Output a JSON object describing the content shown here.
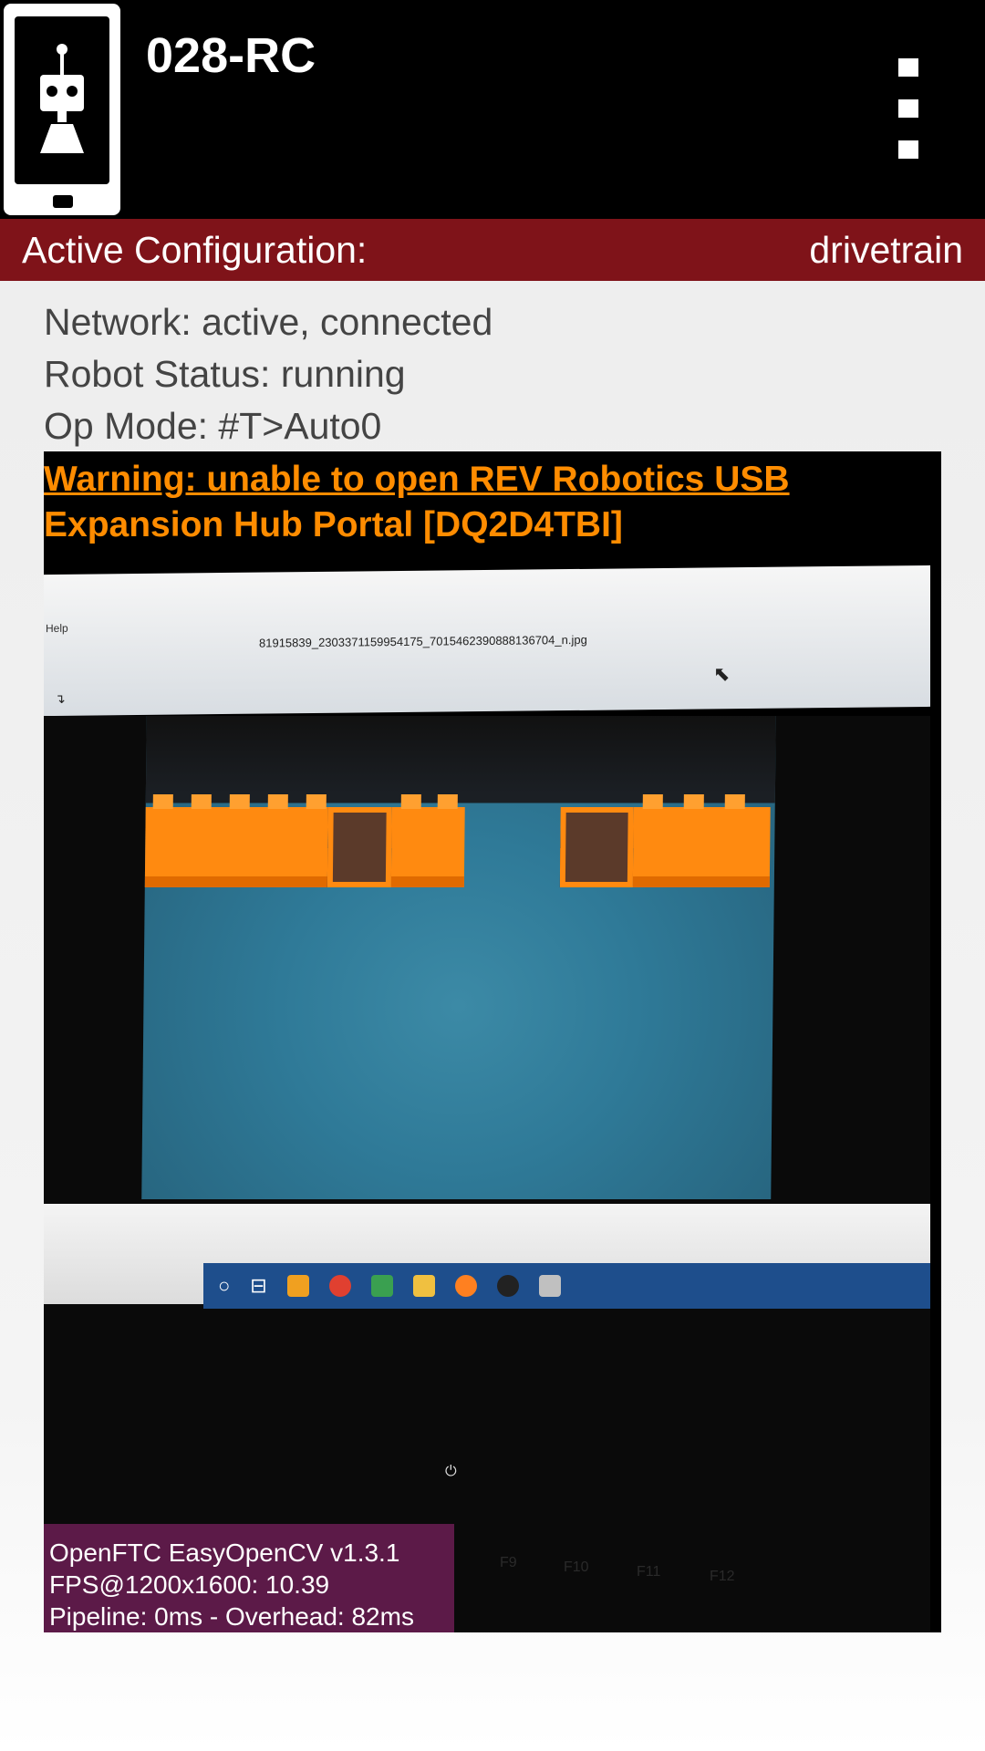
{
  "app": {
    "title": "028-RC",
    "icon": "robot-phone-icon",
    "menu_icon": "overflow-menu-icon"
  },
  "config": {
    "label": "Active Configuration:",
    "value": "drivetrain"
  },
  "status": {
    "network": "Network: active, connected",
    "robot": "Robot Status: running",
    "opmode": "Op Mode: #T>Auto0"
  },
  "warning": {
    "line1": "Warning: unable to open REV Robotics USB",
    "line2": "Expansion Hub Portal [DQ2D4TBI]"
  },
  "camera": {
    "menu_text": "Help",
    "filename": "81915839_2303371159954175_7015462390888136704_n.jpg"
  },
  "easyopencv": {
    "line1": "OpenFTC EasyOpenCV v1.3.1",
    "line2": "FPS@1200x1600: 10.39",
    "line3": "Pipeline: 0ms - Overhead: 82ms"
  },
  "colors": {
    "appbar": "#000000",
    "config_bar": "#7f1319",
    "warning": "#ff8c00",
    "cv_box": "#5c1a48"
  }
}
